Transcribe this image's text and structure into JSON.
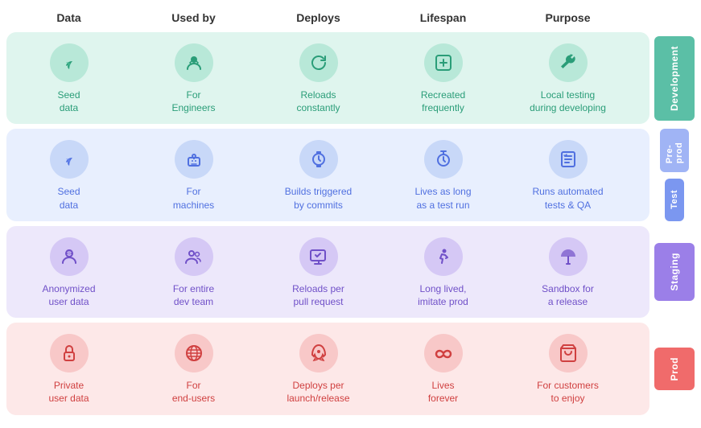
{
  "headers": [
    "Data",
    "Used by",
    "Deploys",
    "Lifespan",
    "Purpose",
    ""
  ],
  "sections": [
    {
      "id": "development",
      "label": "Development",
      "bgClass": "dev-bg",
      "iconClass": "dev-icon",
      "labelBg": "#5bbfa6",
      "labelColor": "#fff",
      "cells": [
        {
          "icon": "🌱",
          "text": "Seed\ndata"
        },
        {
          "icon": "👩‍💻",
          "text": "For\nEngineers"
        },
        {
          "icon": "🔄",
          "text": "Reloads\nconstantly"
        },
        {
          "icon": "🔁",
          "text": "Recreated\nfrequently"
        },
        {
          "icon": "🔧",
          "text": "Local testing\nduring developing"
        }
      ]
    },
    {
      "id": "test",
      "label": "Pre-prod",
      "sublabel": "Test",
      "bgClass": "test-bg",
      "iconClass": "test-icon",
      "labelBg": "#7b97f0",
      "labelColor": "#fff",
      "cells": [
        {
          "icon": "🌱",
          "text": "Seed\ndata"
        },
        {
          "icon": "🤖",
          "text": "For\nmachines"
        },
        {
          "icon": "⌚",
          "text": "Builds triggered\nby commits"
        },
        {
          "icon": "⏱",
          "text": "Lives as long\nas a test run"
        },
        {
          "icon": "☑️",
          "text": "Runs automated\ntests & QA"
        }
      ]
    },
    {
      "id": "staging",
      "label": "Staging",
      "bgClass": "staging-bg",
      "iconClass": "staging-icon",
      "labelBg": "#9b7fe8",
      "labelColor": "#fff",
      "cells": [
        {
          "icon": "🕵️",
          "text": "Anonymized\nuser data"
        },
        {
          "icon": "👥",
          "text": "For entire\ndev team"
        },
        {
          "icon": "📋",
          "text": "Reloads per\npull request"
        },
        {
          "icon": "🚶",
          "text": "Long lived,\nimitate prod"
        },
        {
          "icon": "🎪",
          "text": "Sandbox for\na release"
        }
      ]
    },
    {
      "id": "prod",
      "label": "Prod",
      "bgClass": "prod-bg",
      "iconClass": "prod-icon",
      "labelBg": "#f06b6b",
      "labelColor": "#fff",
      "cells": [
        {
          "icon": "🔒",
          "text": "Private\nuser data"
        },
        {
          "icon": "🌐",
          "text": "For\nend-users"
        },
        {
          "icon": "🚀",
          "text": "Deploys per\nlaunch/release"
        },
        {
          "icon": "∞",
          "text": "Lives\nforever"
        },
        {
          "icon": "🛒",
          "text": "For customers\nto enjoy"
        }
      ]
    }
  ],
  "preprod_label": "Pre-prod",
  "test_sublabel": "Test"
}
